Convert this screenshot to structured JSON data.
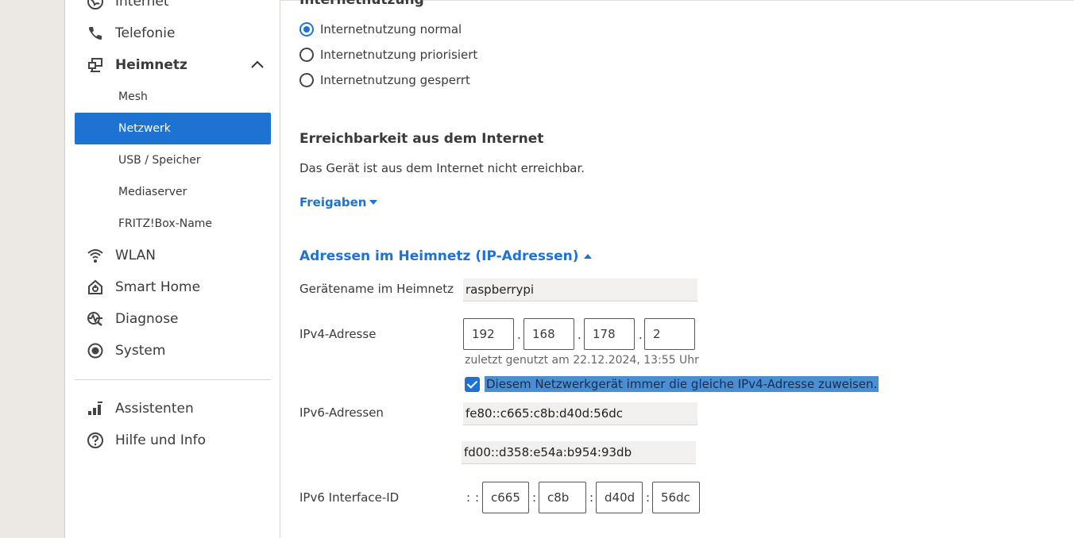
{
  "sidebar": {
    "items": [
      {
        "label": "Internet",
        "icon": "globe-icon"
      },
      {
        "label": "Telefonie",
        "icon": "phone-icon"
      },
      {
        "label": "Heimnetz",
        "icon": "network-icon"
      },
      {
        "label": "WLAN",
        "icon": "wifi-icon"
      },
      {
        "label": "Smart Home",
        "icon": "smart-home-icon"
      },
      {
        "label": "Diagnose",
        "icon": "diagnose-icon"
      },
      {
        "label": "System",
        "icon": "system-icon"
      },
      {
        "label": "Assistenten",
        "icon": "assistant-icon"
      },
      {
        "label": "Hilfe und Info",
        "icon": "help-icon"
      }
    ],
    "heimnetz_sub": [
      "Mesh",
      "Netzwerk",
      "USB / Speicher",
      "Mediaserver",
      "FRITZ!Box-Name"
    ],
    "active_sub": "Netzwerk"
  },
  "main": {
    "usage_heading": "Internetnutzung",
    "usage_options": [
      "Internetnutzung normal",
      "Internetnutzung priorisiert",
      "Internetnutzung gesperrt"
    ],
    "usage_selected": "Internetnutzung normal",
    "reach_heading": "Erreichbarkeit aus dem Internet",
    "reach_text": "Das Gerät ist aus dem Internet nicht erreichbar.",
    "freigaben_link": "Freigaben",
    "ip_heading": "Adressen im Heimnetz (IP-Adressen)",
    "device_name_label": "Gerätename im Heimnetz",
    "device_name": "raspberrypi",
    "ipv4_label": "IPv4-Adresse",
    "ipv4": [
      "192",
      "168",
      "178",
      "2"
    ],
    "ipv4_sep": ".",
    "last_used": "zuletzt genutzt am 22.12.2024, 13:55 Uhr",
    "same_ip_label": "Diesem Netzwerkgerät immer die gleiche IPv4-Adresse zuweisen.",
    "same_ip_checked": true,
    "ipv6_label": "IPv6-Adressen",
    "ipv6_addresses": [
      "fe80::c665:c8b:d40d:56dc",
      "fd00::d358:e54a:b954:93db"
    ],
    "ipv6_iid_label": "IPv6 Interface-ID",
    "ipv6_iid": [
      "c665",
      "c8b",
      "d40d",
      "56dc"
    ],
    "ipv6_sep": ":"
  },
  "colors": {
    "accent": "#1e73d2",
    "selection": "#4a8fd6",
    "background": "#ece9e4"
  }
}
